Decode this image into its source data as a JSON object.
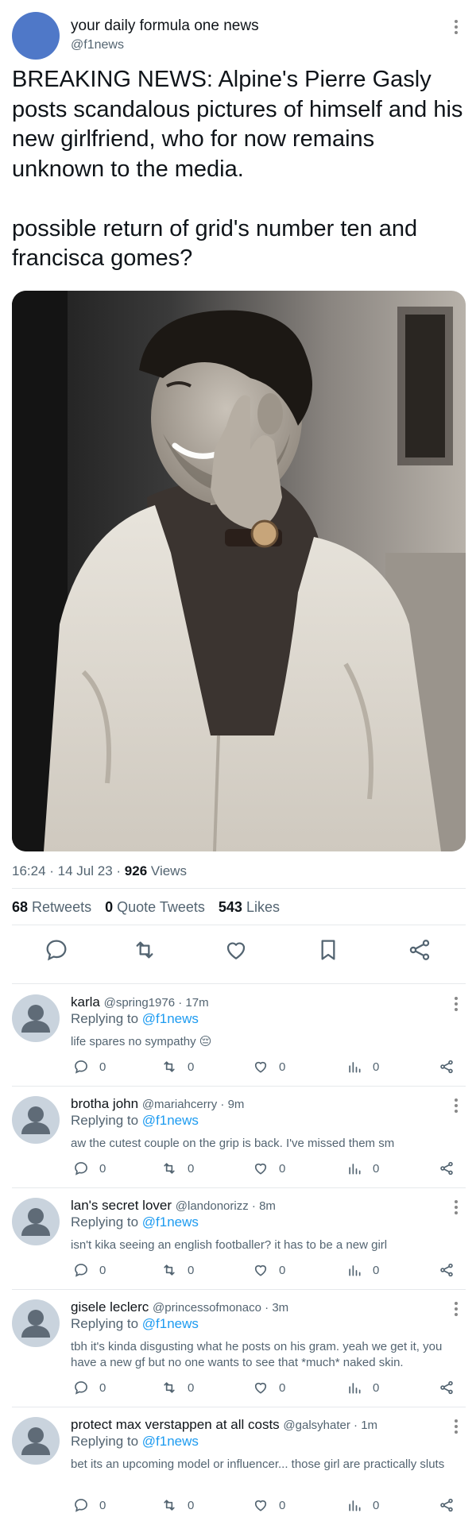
{
  "tweet": {
    "author_name": "your daily formula one news",
    "author_handle": "@f1news",
    "text_para1": "BREAKING NEWS: Alpine's Pierre Gasly posts scandalous pictures of himself and his new girlfriend, who for now remains unknown to the media.",
    "text_para2": "possible return of grid's number ten and francisca gomes?",
    "time": "16:24",
    "date": "14 Jul 23",
    "views_count": "926",
    "views_label": "Views",
    "retweets_count": "68",
    "retweets_label": "Retweets",
    "quotes_count": "0",
    "quotes_label": "Quote Tweets",
    "likes_count": "543",
    "likes_label": "Likes",
    "icons": [
      "reply-icon",
      "retweet-icon",
      "like-icon",
      "bookmark-icon",
      "share-icon"
    ]
  },
  "colors": {
    "accent": "#1d9bf0",
    "main_avatar": "#4f78c8",
    "secondary_text": "#536471"
  },
  "replies": [
    {
      "name": "karla",
      "handle": "@spring1976",
      "time": "17m",
      "replying_label": "Replying to",
      "replying_to": "@f1news",
      "text": "life spares no sympathy 😔",
      "reply_count": "0",
      "retweet_count": "0",
      "like_count": "0",
      "views_count": "0"
    },
    {
      "name": "brotha john",
      "handle": "@mariahcerry",
      "time": "9m",
      "replying_label": "Replying to",
      "replying_to": "@f1news",
      "text": "aw the cutest couple on the grip is back. I've missed them sm",
      "reply_count": "0",
      "retweet_count": "0",
      "like_count": "0",
      "views_count": "0"
    },
    {
      "name": "lan's secret lover",
      "handle": "@landonorizz",
      "time": "8m",
      "replying_label": "Replying to",
      "replying_to": "@f1news",
      "text": "isn't kika seeing an english footballer? it has to be a new girl",
      "reply_count": "0",
      "retweet_count": "0",
      "like_count": "0",
      "views_count": "0"
    },
    {
      "name": "gisele leclerc",
      "handle": "@princessofmonaco",
      "time": "3m",
      "replying_label": "Replying to",
      "replying_to": "@f1news",
      "text": "tbh it's kinda disgusting what he posts on his gram. yeah we get it, you have a new gf but no one wants to see that *much* naked skin.",
      "reply_count": "0",
      "retweet_count": "0",
      "like_count": "0",
      "views_count": "0"
    },
    {
      "name": "protect max verstappen at all costs",
      "handle": "@galsyhater",
      "time": "1m",
      "replying_label": "Replying to",
      "replying_to": "@f1news",
      "text": "bet its an upcoming model or influencer... those girl are practically sluts",
      "reply_count": "0",
      "retweet_count": "0",
      "like_count": "0",
      "views_count": "0"
    }
  ]
}
